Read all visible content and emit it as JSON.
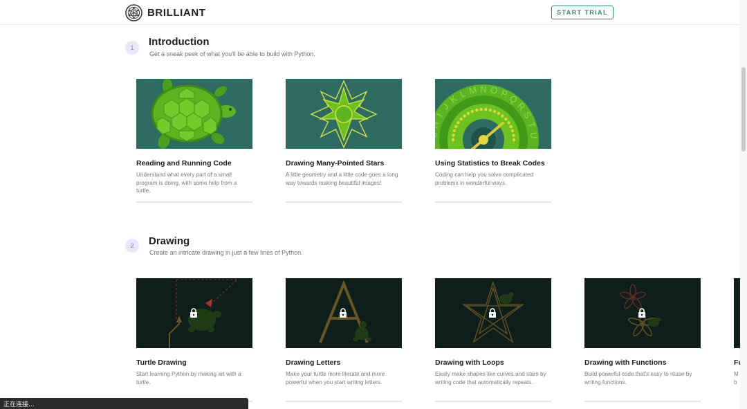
{
  "header": {
    "brand": "BRILLIANT",
    "cta_label": "START TRIAL"
  },
  "chapters": [
    {
      "number": "1",
      "title": "Introduction",
      "subtitle": "Get a sneak peek of what you'll be able to build with Python.",
      "cards": [
        {
          "title": "Reading and Running Code",
          "description": "Understand what every part of a small program is doing, with some help from a turtle.",
          "locked": false
        },
        {
          "title": "Drawing Many-Pointed Stars",
          "description": "A little geometry and a little code goes a long way towards making beautiful images!",
          "locked": false
        },
        {
          "title": "Using Statistics to Break Codes",
          "description": "Coding can help you solve complicated problems in wonderful ways.",
          "locked": false
        }
      ]
    },
    {
      "number": "2",
      "title": "Drawing",
      "subtitle": "Create an intricate drawing in just a few lines of Python.",
      "cards": [
        {
          "title": "Turtle Drawing",
          "description": "Start learning Python by making art with a turtle.",
          "locked": true
        },
        {
          "title": "Drawing Letters",
          "description": "Make your turtle more literate and more powerful when you start writing letters.",
          "locked": true
        },
        {
          "title": "Drawing with Loops",
          "description": "Easily make shapes like curves and stars by writing code that automatically repeats.",
          "locked": true
        },
        {
          "title": "Drawing with Functions",
          "description": "Build powerful code that's easy to reuse by writing functions.",
          "locked": true
        },
        {
          "title": "Fu",
          "description": "M\nb",
          "locked": true
        }
      ]
    }
  ],
  "cipher_letters": "GHIJKLMNOPQRSTU",
  "status_bar": {
    "text": "正在连接..."
  },
  "colors": {
    "accent": "#2e8b7a",
    "teal_bg": "#2e6b62",
    "dark_bg": "#0e1f1b",
    "turtle_green": "#5bb520",
    "badge_bg": "#ece6fb"
  }
}
